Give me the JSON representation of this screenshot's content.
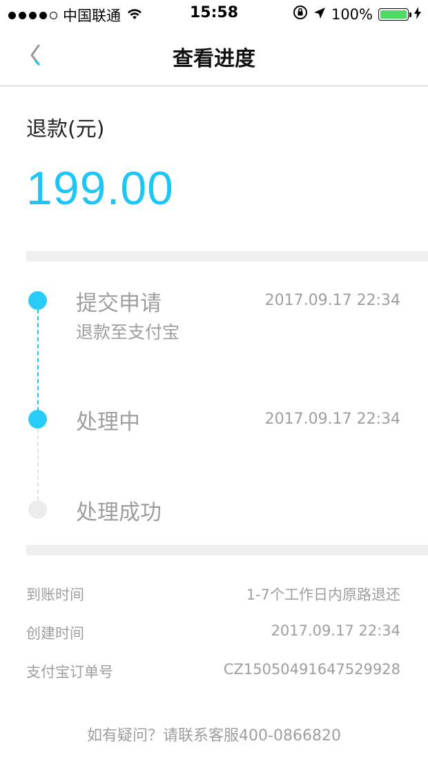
{
  "status_bar": {
    "carrier": "中国联通",
    "time": "15:58",
    "battery": "100%",
    "battery_level": 1.0,
    "signal_bars": 4
  },
  "nav": {
    "title": "查看进度",
    "back_icon": "chevron-left-icon"
  },
  "refund": {
    "label": "退款(元)",
    "amount": "199.00",
    "accent_color": "#1ec6f6"
  },
  "steps": [
    {
      "title": "提交申请",
      "subtitle": "退款至支付宝",
      "time": "2017.09.17 22:34",
      "state": "done"
    },
    {
      "title": "处理中",
      "subtitle": "",
      "time": "2017.09.17 22:34",
      "state": "done"
    },
    {
      "title": "处理成功",
      "subtitle": "",
      "time": "",
      "state": "pending"
    }
  ],
  "details": [
    {
      "label": "到账时间",
      "value": "1-7个工作日内原路退还"
    },
    {
      "label": "创建时间",
      "value": "2017.09.17 22:34"
    },
    {
      "label": "支付宝订单号",
      "value": "CZ15050491647529928"
    }
  ],
  "footer": {
    "text": "如有疑问？请联系客服400-0866820"
  }
}
